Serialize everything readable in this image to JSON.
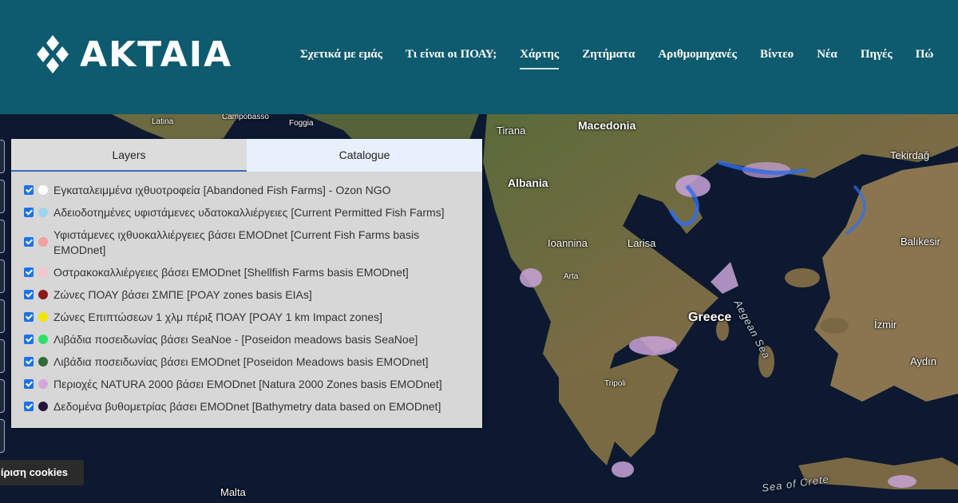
{
  "brand": {
    "name": "AKTAIA"
  },
  "nav": [
    {
      "label": "Σχετικά με εμάς",
      "active": false
    },
    {
      "label": "Τι είναι οι ΠΟΑΥ;",
      "active": false
    },
    {
      "label": "Χάρτης",
      "active": true
    },
    {
      "label": "Ζητήματα",
      "active": false
    },
    {
      "label": "Αριθμομηχανές",
      "active": false
    },
    {
      "label": "Βίντεο",
      "active": false
    },
    {
      "label": "Νέα",
      "active": false
    },
    {
      "label": "Πηγές",
      "active": false
    },
    {
      "label": "Πώ",
      "active": false
    }
  ],
  "panel": {
    "tabs": [
      "Layers",
      "Catalogue"
    ],
    "layers": [
      {
        "label": "Εγκαταλειμμένα ιχθυοτροφεία [Abandoned Fish Farms] - Ozon NGO",
        "color": "#ffffff",
        "checked": true
      },
      {
        "label": "Αδειοδοτημένες υφιστάμενες υδατοκαλλιέργειες [Current Permitted Fish Farms]",
        "color": "#9fd3f0",
        "checked": true
      },
      {
        "label": "Υφιστάμενες ιχθυοκαλλιέργειες βάσει EMODnet [Current Fish Farms basis EMODnet]",
        "color": "#f2a0a0",
        "checked": true
      },
      {
        "label": "Οστρακοκαλλιέργειες βάσει EMODnet [Shellfish Farms basis EMODnet]",
        "color": "#f5c6cc",
        "checked": true
      },
      {
        "label": "Ζώνες ΠΟΑΥ βάσει ΣΜΠΕ [POAY zones basis EIAs]",
        "color": "#8b1a1a",
        "checked": true
      },
      {
        "label": "Ζώνες Επιπτώσεων 1 χλμ πέριξ ΠΟΑΥ [POAY 1 km Impact zones]",
        "color": "#f2e600",
        "checked": true
      },
      {
        "label": "Λιβάδια ποσειδωνίας βάσει SeaNoe - [Poseidon meadows basis SeaNoe]",
        "color": "#2ee06a",
        "checked": true
      },
      {
        "label": "Λιβάδια ποσειδωνίας βάσει EMODnet [Poseidon Meadows basis EMODnet]",
        "color": "#2f6b3a",
        "checked": true
      },
      {
        "label": "Περιοχές NATURA 2000 βάσει EMODnet [Natura 2000 Zones basis EMODnet]",
        "color": "#d4a8dc",
        "checked": true
      },
      {
        "label": "Δεδομένα βυθομετρίας βάσει EMODnet [Bathymetry data based on EMODnet]",
        "color": "#22163a",
        "checked": true
      }
    ]
  },
  "map": {
    "labels": {
      "latina": "Latina",
      "campobasso": "Campobasso",
      "foggia": "Foggia",
      "tirana": "Tirana",
      "macedonia": "Macedonia",
      "albania": "Albania",
      "tekirdag": "Tekirdağ",
      "ioannina": "Ioannina",
      "larisa": "Larisa",
      "balikesir": "Balıkesir",
      "arta": "Arta",
      "aegean_sea": "Aegean Sea",
      "greece": "Greece",
      "izmir": "İzmir",
      "tripoli": "Tripoli",
      "aydin": "Aydın",
      "malta": "Malta",
      "sea_of_crete": "Sea of Crete"
    }
  },
  "cookies": {
    "label": "ίριση cookies"
  }
}
